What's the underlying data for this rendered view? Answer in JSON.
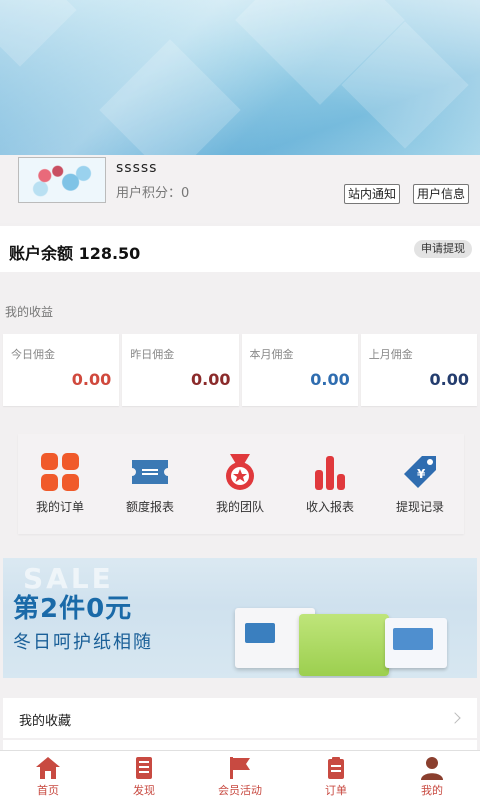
{
  "profile": {
    "username": "sssss",
    "points_label": "用户积分：0",
    "notice_button": "站内通知",
    "info_button": "用户信息"
  },
  "account": {
    "balance_label": "账户余额 128.50",
    "withdraw_button": "申请提现"
  },
  "earnings": {
    "title": "我的收益",
    "cards": [
      {
        "label": "今日佣金",
        "value": "0.00",
        "color": "#d0493d"
      },
      {
        "label": "昨日佣金",
        "value": "0.00",
        "color": "#8b2b2b"
      },
      {
        "label": "本月佣金",
        "value": "0.00",
        "color": "#2f6db0"
      },
      {
        "label": "上月佣金",
        "value": "0.00",
        "color": "#243d6e"
      }
    ]
  },
  "grid": {
    "items": [
      {
        "label": "我的订单",
        "icon": "orders-grid-icon",
        "color": "#f05a2a"
      },
      {
        "label": "额度报表",
        "icon": "ticket-icon",
        "color": "#3b79b4"
      },
      {
        "label": "我的团队",
        "icon": "medal-star-icon",
        "color": "#e0393c"
      },
      {
        "label": "收入报表",
        "icon": "bar-chart-icon",
        "color": "#e0393c"
      },
      {
        "label": "提现记录",
        "icon": "yen-tag-icon",
        "color": "#2f6db0"
      }
    ]
  },
  "banner": {
    "sale_text": "SALE",
    "headline": "第2件0元",
    "subline": "冬日呵护纸相随"
  },
  "list": {
    "items": [
      {
        "label": "我的收藏"
      }
    ]
  },
  "tabbar": {
    "items": [
      {
        "label": "首页",
        "icon": "home-icon"
      },
      {
        "label": "发现",
        "icon": "document-icon"
      },
      {
        "label": "会员活动",
        "icon": "flag-icon"
      },
      {
        "label": "订单",
        "icon": "clipboard-icon"
      },
      {
        "label": "我的",
        "icon": "user-icon"
      }
    ],
    "active_color": "#c84a41"
  }
}
